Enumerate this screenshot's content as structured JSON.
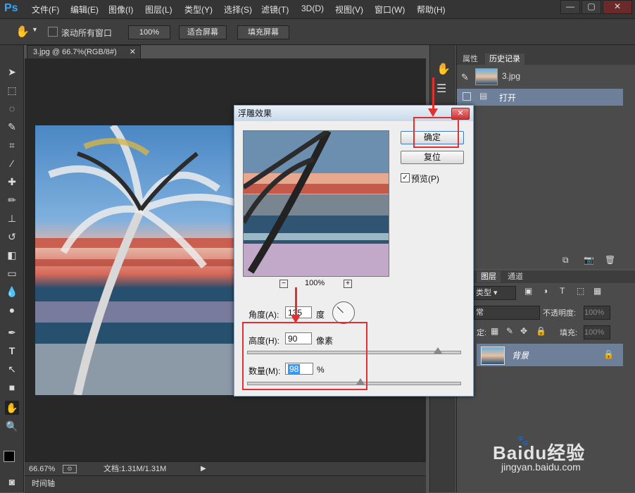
{
  "app": {
    "logo": "Ps"
  },
  "menu": [
    "文件(F)",
    "编辑(E)",
    "图像(I)",
    "图层(L)",
    "类型(Y)",
    "选择(S)",
    "滤镜(T)",
    "3D(D)",
    "视图(V)",
    "窗口(W)",
    "帮助(H)"
  ],
  "window_controls": [
    "—",
    "▢",
    "✕"
  ],
  "options": {
    "scroll_all_label": "滚动所有窗口",
    "zoom_100": "100%",
    "fit_screen": "适合屏幕",
    "fill_screen": "填充屏幕"
  },
  "document": {
    "tab_title": "3.jpg @ 66.7%(RGB/8#)",
    "zoom": "66.67%",
    "doc_size": "文档:1.31M/1.31M",
    "timeline": "时间轴"
  },
  "panels": {
    "top_tabs": [
      "属性",
      "历史记录"
    ],
    "history_snapshot": "3.jpg",
    "history_item": "打开",
    "bottom_tabs": [
      "图层",
      "通道"
    ],
    "kind_label": "类型",
    "blend_mode": "常",
    "opacity_label": "不透明度:",
    "opacity_value": "100%",
    "lock_label": "定:",
    "fill_label": "填充:",
    "fill_value": "100%",
    "layer_name": "背景"
  },
  "dialog": {
    "title": "浮雕效果",
    "ok": "确定",
    "reset": "复位",
    "preview_label": "预览(P)",
    "preview_checked": true,
    "zoom": "100%",
    "angle_label": "角度(A):",
    "angle_value": "135",
    "angle_unit": "度",
    "height_label": "高度(H):",
    "height_value": "90",
    "height_unit": "像素",
    "amount_label": "数量(M):",
    "amount_value": "98",
    "amount_unit": "%"
  },
  "watermark": {
    "brand": "Baidu经验",
    "url": "jingyan.baidu.com"
  },
  "colors": {
    "annotation_red": "#e03030",
    "accent_blue": "#31a8ff"
  }
}
